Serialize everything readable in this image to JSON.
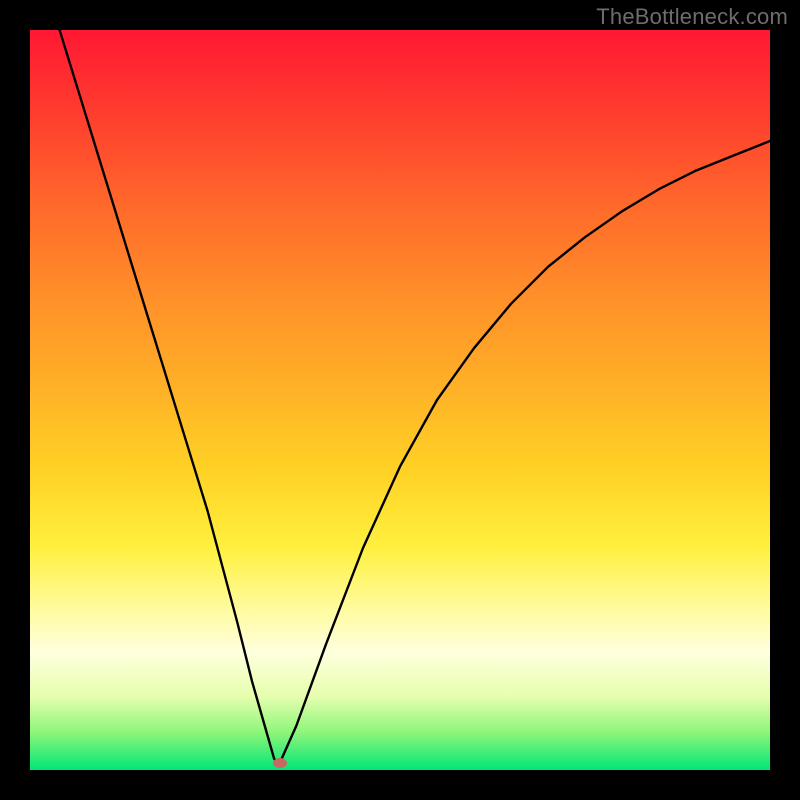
{
  "watermark": "TheBottleneck.com",
  "chart_data": {
    "type": "line",
    "title": "",
    "xlabel": "",
    "ylabel": "",
    "xlim": [
      0,
      100
    ],
    "ylim": [
      0,
      100
    ],
    "series": [
      {
        "name": "curve",
        "x": [
          4,
          8,
          12,
          16,
          20,
          24,
          28,
          30,
          32,
          33,
          33.5,
          34,
          36,
          40,
          45,
          50,
          55,
          60,
          65,
          70,
          75,
          80,
          85,
          90,
          95,
          100
        ],
        "y": [
          100,
          87,
          74,
          61,
          48,
          35,
          20,
          12,
          5,
          1.5,
          1,
          1.5,
          6,
          17,
          30,
          41,
          50,
          57,
          63,
          68,
          72,
          75.5,
          78.5,
          81,
          83,
          85
        ]
      }
    ],
    "marker": {
      "x": 33.8,
      "y": 1
    },
    "colors": {
      "curve": "#000000",
      "marker": "#c76862",
      "gradient_top": "#ff1833",
      "gradient_bottom": "#00e677"
    }
  }
}
